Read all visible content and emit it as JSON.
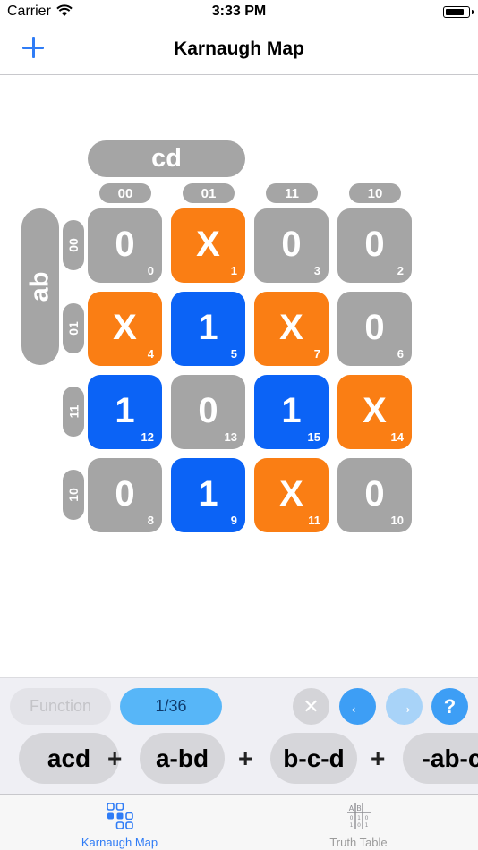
{
  "status_bar": {
    "carrier": "Carrier",
    "time": "3:33 PM"
  },
  "nav": {
    "title": "Karnaugh Map",
    "add_icon": "plus-icon"
  },
  "kmap": {
    "column_variable": "cd",
    "row_variable": "ab",
    "column_labels": [
      "00",
      "01",
      "11",
      "10"
    ],
    "row_labels": [
      "00",
      "01",
      "11",
      "10"
    ],
    "colors": {
      "zero": "#a5a5a5",
      "dont_care": "#fa7e14",
      "one": "#0b63f6"
    },
    "cells": [
      [
        {
          "value": "0",
          "index": "0"
        },
        {
          "value": "X",
          "index": "1"
        },
        {
          "value": "0",
          "index": "3"
        },
        {
          "value": "0",
          "index": "2"
        }
      ],
      [
        {
          "value": "X",
          "index": "4"
        },
        {
          "value": "1",
          "index": "5"
        },
        {
          "value": "X",
          "index": "7"
        },
        {
          "value": "0",
          "index": "6"
        }
      ],
      [
        {
          "value": "1",
          "index": "12"
        },
        {
          "value": "0",
          "index": "13"
        },
        {
          "value": "1",
          "index": "15"
        },
        {
          "value": "X",
          "index": "14"
        }
      ],
      [
        {
          "value": "0",
          "index": "8"
        },
        {
          "value": "1",
          "index": "9"
        },
        {
          "value": "X",
          "index": "11"
        },
        {
          "value": "0",
          "index": "10"
        }
      ]
    ]
  },
  "controls": {
    "function_label": "Function",
    "solution_counter": "1/36",
    "clear_symbol": "✕",
    "prev_symbol": "←",
    "next_symbol": "→",
    "help_symbol": "?"
  },
  "expression": {
    "terms": [
      "acd",
      "a-bd",
      "b-c-d",
      "-ab-c"
    ],
    "operator": "+"
  },
  "tab_bar": {
    "tabs": [
      {
        "label": "Karnaugh Map",
        "icon": "grid-dots-icon",
        "active": true
      },
      {
        "label": "Truth Table",
        "icon": "truth-table-icon",
        "active": false
      }
    ]
  }
}
